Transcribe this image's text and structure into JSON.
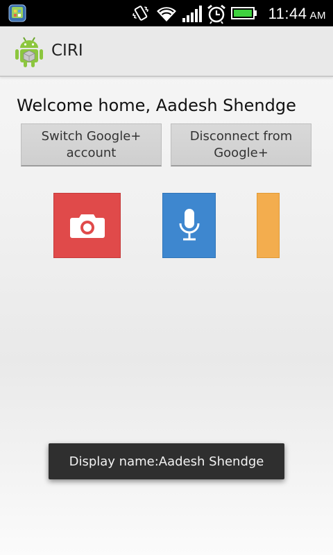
{
  "status_bar": {
    "time": "11:44",
    "ampm": "AM",
    "icons": [
      "notification-app-icon",
      "vibrate-icon",
      "wifi-icon",
      "signal-icon",
      "alarm-icon",
      "battery-icon"
    ]
  },
  "action_bar": {
    "title": "CIRI",
    "icon": "android-app-icon"
  },
  "main": {
    "welcome": "Welcome home, Aadesh Shendge",
    "buttons": [
      {
        "label": "Switch Google+ account"
      },
      {
        "label": "Disconnect from Google+"
      }
    ],
    "tiles": [
      {
        "icon": "camera-icon",
        "color": "#e04a4a"
      },
      {
        "icon": "microphone-icon",
        "color": "#3e87cf"
      },
      {
        "icon": "",
        "color": "#f3ad4e"
      }
    ]
  },
  "toast": {
    "text": "Display name:Aadesh Shendge"
  }
}
